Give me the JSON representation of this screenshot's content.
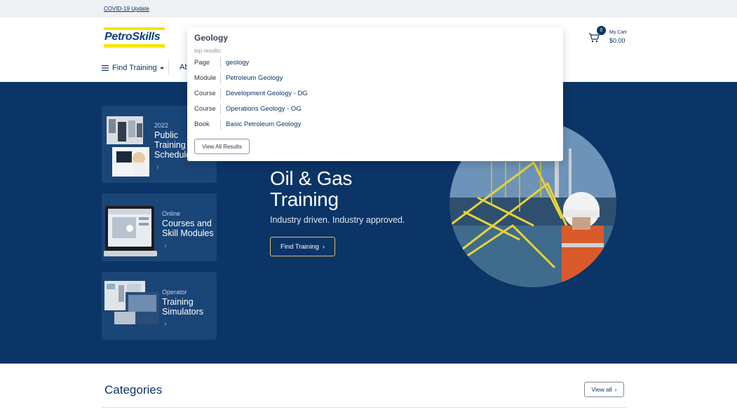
{
  "topbar": {
    "covid_link": "COVID-19 Update"
  },
  "header": {
    "logo_text": "PetroSkills",
    "nav": {
      "find_training": "Find Training",
      "about_partial": "Ab"
    },
    "cart": {
      "count": "0",
      "label": "My Cart",
      "total": "$0.00"
    }
  },
  "search": {
    "query": "Geology",
    "top_results_label": "top results:",
    "results": [
      {
        "type": "Page",
        "title": "geology"
      },
      {
        "type": "Module",
        "title": "Petroleum Geology"
      },
      {
        "type": "Course",
        "title": "Development Geology - DG"
      },
      {
        "type": "Course",
        "title": "Operations Geology - OG"
      },
      {
        "type": "Book",
        "title": "Basic Petroleum Geology"
      }
    ],
    "view_all_label": "View All Results"
  },
  "hero": {
    "title_line1": "Oil & Gas",
    "title_line2": "Training",
    "subtitle": "Industry driven. Industry approved.",
    "cta": "Find Training",
    "cards": [
      {
        "meta": "2022",
        "title_lines": [
          "Public",
          "Training",
          "Schedule"
        ]
      },
      {
        "meta": "Online",
        "title_lines": [
          "Courses and",
          "Skill Modules"
        ]
      },
      {
        "meta": "Operator",
        "title_lines": [
          "Training",
          "Simulators"
        ]
      }
    ]
  },
  "categories": {
    "title": "Categories",
    "view_all": "View all"
  },
  "colors": {
    "navy": "#0b3467",
    "card": "#1a4577",
    "accent_yellow": "#f5e500",
    "cta_border": "#e2c35b"
  }
}
